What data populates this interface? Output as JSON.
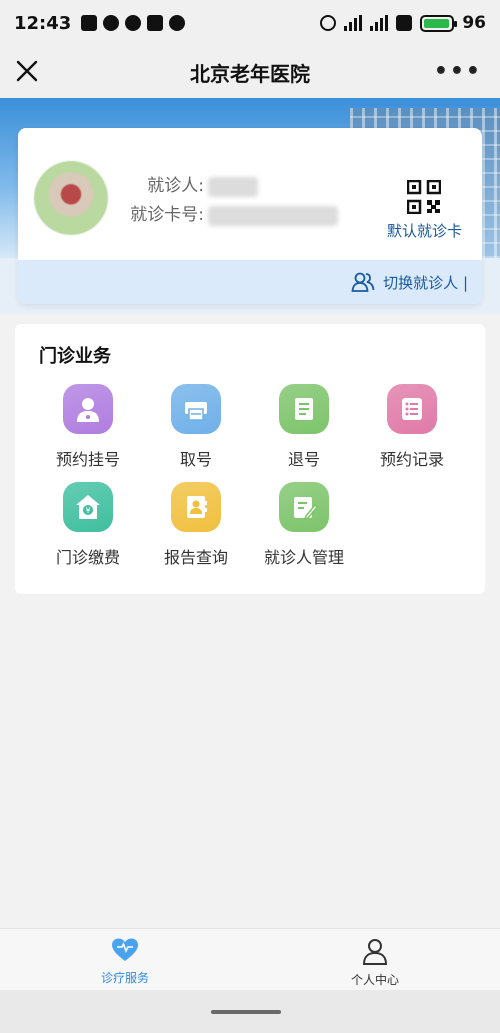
{
  "status": {
    "time": "12:43",
    "battery": "96",
    "battery_level": 0.96
  },
  "nav": {
    "title": "北京老年医院"
  },
  "patient": {
    "name_label": "就诊人:",
    "card_label": "就诊卡号:",
    "qr_label": "默认就诊卡",
    "switch_label": "切换就诊人 |"
  },
  "services": {
    "title": "门诊业务",
    "items": [
      {
        "label": "预约挂号",
        "icon": "doctor-icon",
        "color": "#b07de0"
      },
      {
        "label": "取号",
        "icon": "printer-icon",
        "color": "#6fb0e8"
      },
      {
        "label": "退号",
        "icon": "document-icon",
        "color": "#7cc46a"
      },
      {
        "label": "预约记录",
        "icon": "list-icon",
        "color": "#e07aa8"
      },
      {
        "label": "门诊缴费",
        "icon": "payment-icon",
        "color": "#3fbf9f"
      },
      {
        "label": "报告查询",
        "icon": "report-icon",
        "color": "#f0c03e"
      },
      {
        "label": "就诊人管理",
        "icon": "edit-icon",
        "color": "#7cc46a"
      }
    ]
  },
  "tabs": [
    {
      "label": "诊疗服务",
      "icon": "heart-icon",
      "color": "#2f8be0"
    },
    {
      "label": "个人中心",
      "icon": "user-icon",
      "color": "#333333"
    }
  ]
}
